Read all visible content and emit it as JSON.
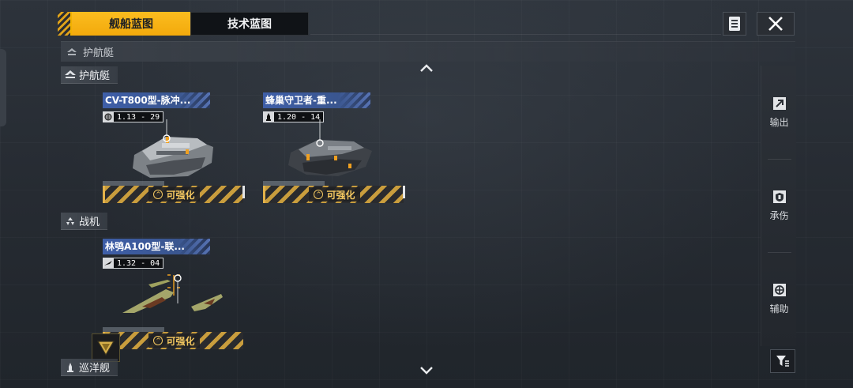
{
  "tabs": [
    {
      "label": "舰船蓝图",
      "active": true
    },
    {
      "label": "技术蓝图",
      "active": false
    }
  ],
  "toolbar": {
    "doc_icon": "document-icon",
    "close_icon": "close-icon"
  },
  "section_header": {
    "label": "护航艇",
    "icon": "escort-icon"
  },
  "categories": {
    "escort": {
      "label": "护航艇",
      "icon": "escort-icon"
    },
    "fighter": {
      "label": "战机",
      "icon": "fighter-icon"
    },
    "cruiser": {
      "label": "巡洋舰",
      "icon": "cruiser-icon"
    }
  },
  "cards": [
    {
      "name": "CV-T800型-脉冲...",
      "version": "1.13 - 29",
      "badge": "可强化",
      "type_icon": "globe-icon"
    },
    {
      "name": "蜂巢守卫者-重...",
      "version": "1.20 - 14",
      "badge": "可强化",
      "type_icon": "missile-icon"
    },
    {
      "name": "林鸮A100型-联...",
      "version": "1.32 - 04",
      "badge": "可强化",
      "type_icon": "wing-icon"
    }
  ],
  "sidebar": {
    "items": [
      {
        "label": "输出",
        "icon": "export-arrow-icon"
      },
      {
        "label": "承伤",
        "icon": "shield-icon"
      },
      {
        "label": "辅助",
        "icon": "support-icon"
      }
    ]
  },
  "colors": {
    "accent": "#f3aa0c",
    "name_bar": "#3e5ea8",
    "badge_text": "#f3c760"
  }
}
